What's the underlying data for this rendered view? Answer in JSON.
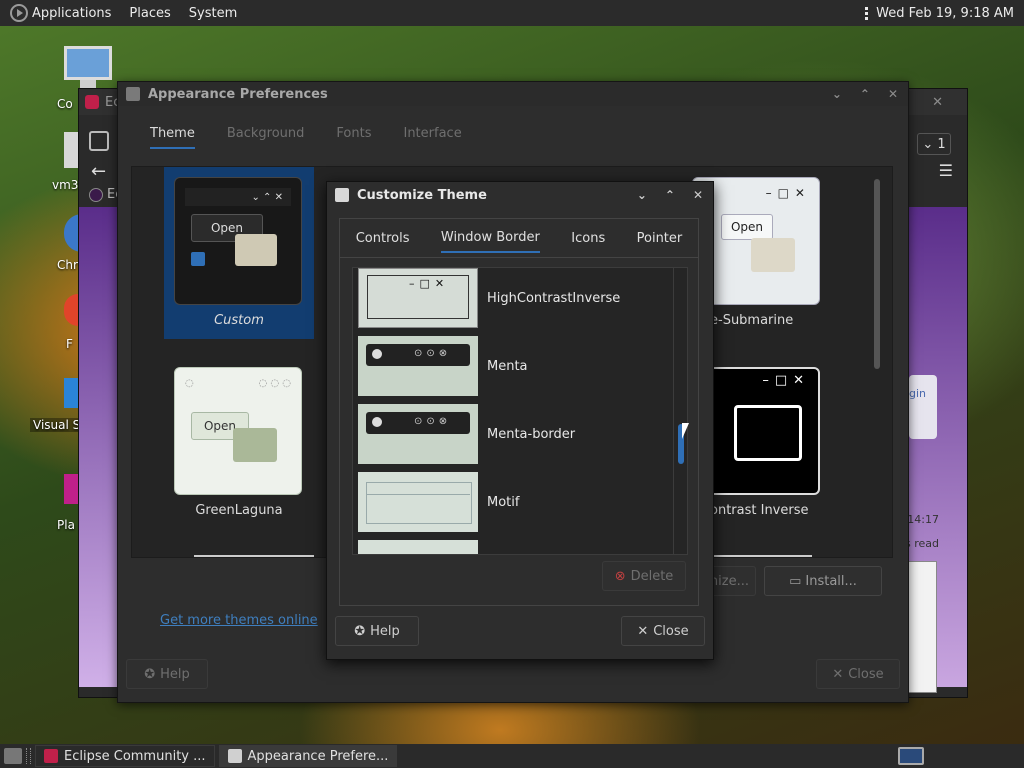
{
  "top_panel": {
    "menus": [
      "Applications",
      "Places",
      "System"
    ],
    "clock": "Wed Feb 19,  9:18 AM"
  },
  "desktop": {
    "icons": [
      "Co",
      "vm3",
      "Chr",
      "F",
      "Visual S",
      "Pla"
    ]
  },
  "background_window": {
    "title": "Ec",
    "side_label": "Ec",
    "counter": "1",
    "time": "14:17",
    "read_label": "s read",
    "login_label": "gin"
  },
  "appearance": {
    "title": "Appearance Preferences",
    "tabs": [
      "Theme",
      "Background",
      "Fonts",
      "Interface"
    ],
    "themes": [
      {
        "name": "Custom",
        "selected": true
      },
      {
        "name": "GreenLaguna",
        "selected": false
      },
      {
        "name": "e-Submarine",
        "selected": false
      },
      {
        "name": "ontrast Inverse",
        "selected": false
      }
    ],
    "preview_open_label": "Open",
    "get_more_link": "Get more themes online",
    "customize_label": "nize...",
    "install_label": "Install...",
    "help_label": "Help",
    "close_label": "Close"
  },
  "customize": {
    "title": "Customize Theme",
    "tabs": [
      "Controls",
      "Window Border",
      "Icons",
      "Pointer"
    ],
    "active_tab": "Window Border",
    "items": [
      "HighContrastInverse",
      "Menta",
      "Menta-border",
      "Motif"
    ],
    "delete_label": "Delete",
    "help_label": "Help",
    "close_label": "Close"
  },
  "taskbar": {
    "tasks": [
      "Eclipse Community ...",
      "Appearance Prefere..."
    ]
  },
  "colors": {
    "accent": "#2f6fb6",
    "selected_bg": "#123d70",
    "window_bg": "#2d2d2d",
    "panel_bg": "#2b2b2b"
  }
}
